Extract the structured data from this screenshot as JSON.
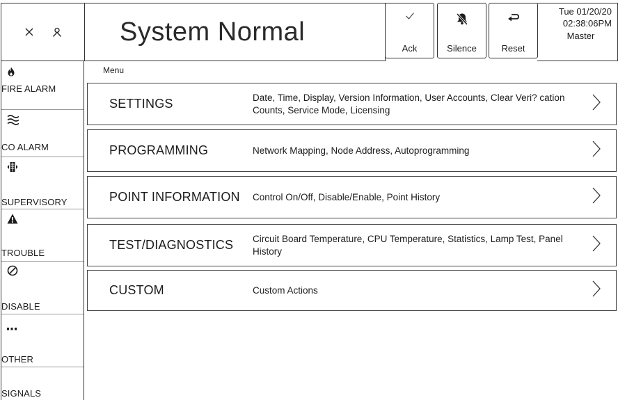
{
  "header": {
    "status": "System Normal",
    "buttons": {
      "ack": "Ack",
      "silence": "Silence",
      "reset": "Reset"
    },
    "datetime": {
      "date": "Tue 01/20/20",
      "time": "02:38:06PM",
      "user": "Master"
    },
    "icons": [
      "close-icon",
      "user-icon",
      "check-icon",
      "bell-off-icon",
      "reset-arrow-icon"
    ]
  },
  "sidebar": {
    "items": [
      {
        "label": "FIRE ALARM",
        "icon": "flame-icon"
      },
      {
        "label": "CO ALARM",
        "icon": "waves-icon"
      },
      {
        "label": "SUPERVISORY",
        "icon": "supervisory-icon"
      },
      {
        "label": "TROUBLE",
        "icon": "warning-icon"
      },
      {
        "label": "DISABLE",
        "icon": "disable-icon"
      },
      {
        "label": "OTHER",
        "icon": "more-icon"
      },
      {
        "label": "SIGNALS SILENCED",
        "icon": ""
      }
    ]
  },
  "main": {
    "title": "Menu",
    "rows": [
      {
        "label": "SETTINGS",
        "description": "Date, Time, Display, Version Information, User Accounts, Clear Veri? cation Counts, Service Mode, Licensing"
      },
      {
        "label": "PROGRAMMING",
        "description": "Network Mapping, Node Address, Autoprogramming"
      },
      {
        "label": "POINT INFORMATION",
        "description": "Control On/Off, Disable/Enable, Point History"
      },
      {
        "label": "TEST/DIAGNOSTICS",
        "description": "Circuit Board Temperature, CPU Temperature, Statistics, Lamp Test, Panel History"
      },
      {
        "label": "CUSTOM",
        "description": "Custom Actions"
      }
    ]
  }
}
